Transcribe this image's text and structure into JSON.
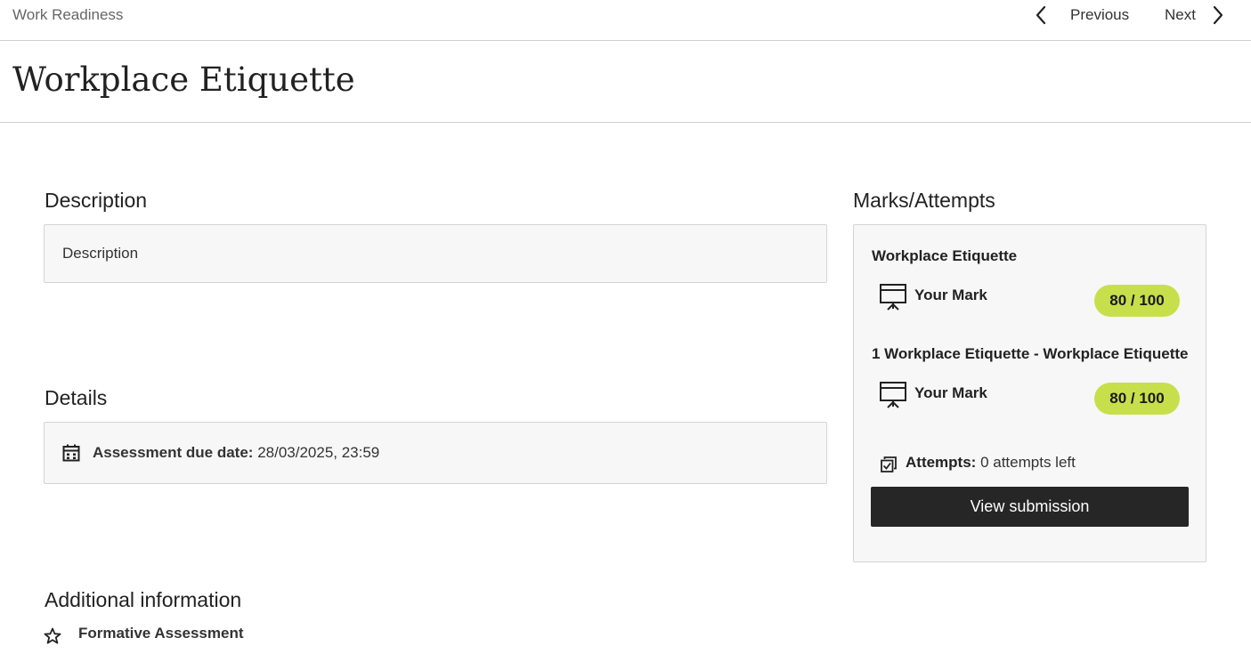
{
  "breadcrumb": "Work Readiness",
  "nav": {
    "previous_label": "Previous",
    "next_label": "Next"
  },
  "page_title": "Workplace Etiquette",
  "description": {
    "heading": "Description",
    "text": "Description"
  },
  "details": {
    "heading": "Details",
    "due_label": "Assessment due date:",
    "due_value": "28/03/2025, 23:59",
    "icon": "calendar-icon"
  },
  "marks": {
    "heading": "Marks/Attempts",
    "items": [
      {
        "title": "Workplace Etiquette",
        "mark_label": "Your Mark",
        "mark_value": "80 / 100",
        "icon": "presentation-board-icon"
      },
      {
        "title": "1 Workplace Etiquette - Workplace Etiquette",
        "mark_label": "Your Mark",
        "mark_value": "80 / 100",
        "icon": "presentation-board-icon"
      }
    ],
    "attempts_label": "Attempts:",
    "attempts_value": "0 attempts left",
    "view_button": "View submission",
    "badge_color": "#c8df4c"
  },
  "additional": {
    "heading": "Additional information",
    "items": [
      {
        "label": "Formative Assessment",
        "icon": "star-icon"
      }
    ]
  }
}
